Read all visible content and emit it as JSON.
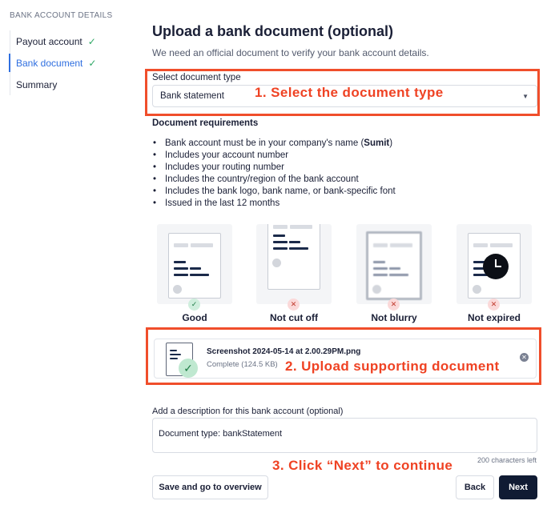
{
  "sidebar": {
    "heading": "BANK ACCOUNT DETAILS",
    "items": [
      {
        "label": "Payout account",
        "status": "complete"
      },
      {
        "label": "Bank document",
        "status": "complete",
        "active": true
      },
      {
        "label": "Summary"
      }
    ]
  },
  "main": {
    "title": "Upload a bank document (optional)",
    "subtitle": "We need an official document to verify your bank account details."
  },
  "document_type": {
    "label": "Select document type",
    "selected": "Bank statement"
  },
  "requirements": {
    "title": "Document requirements",
    "items": [
      "Bank account must be in your company's name (Sumit)",
      "Includes your account number",
      "Includes your routing number",
      "Includes the country/region of the bank account",
      "Includes the bank logo, bank name, or bank-specific font",
      "Issued in the last 12 months"
    ]
  },
  "examples": [
    {
      "label": "Good",
      "result": "ok"
    },
    {
      "label": "Not cut off",
      "result": "bad"
    },
    {
      "label": "Not blurry",
      "result": "bad"
    },
    {
      "label": "Not expired",
      "result": "bad"
    }
  ],
  "upload": {
    "file_name": "Screenshot 2024-05-14 at 2.00.29PM.png",
    "status": "Complete (124.5 KB)"
  },
  "description": {
    "label": "Add a description for this bank account (optional)",
    "value": "Document type: bankStatement",
    "char_count": "200 characters left"
  },
  "actions": {
    "save_overview": "Save and go to overview",
    "back": "Back",
    "next": "Next"
  },
  "annotations": {
    "step1": "1. Select the document type",
    "step2": "2. Upload supporting document",
    "step3": "3. Click “Next” to continue"
  },
  "colors": {
    "annotation": "#ef4223",
    "accent": "#2f6fe0",
    "primary_button": "#101b33",
    "success": "#2fa866"
  }
}
